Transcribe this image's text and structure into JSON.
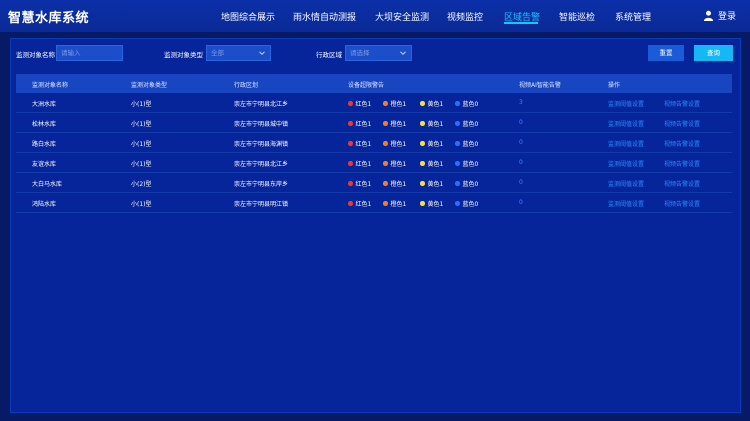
{
  "header": {
    "title": "智慧水库系统",
    "nav": [
      {
        "label": "地图综合展示"
      },
      {
        "label": "雨水情自动测报"
      },
      {
        "label": "大坝安全监测"
      },
      {
        "label": "视频监控"
      },
      {
        "label": "区域告警",
        "active": true
      },
      {
        "label": "智能巡检"
      },
      {
        "label": "系统管理"
      }
    ],
    "login_label": "登录"
  },
  "filters": {
    "name_label": "监测对象名称",
    "name_placeholder": "请输入",
    "type_label": "监测对象类型",
    "type_value": "全部",
    "region_label": "行政区域",
    "region_value": "请选择",
    "reset_label": "重置",
    "query_label": "查询"
  },
  "table": {
    "columns": [
      "监测对象名称",
      "监测对象类型",
      "行政区划",
      "设备超限警告",
      "视频AI智能告警",
      "操作"
    ],
    "alarm_colors": {
      "red": "#e23b3b",
      "orange": "#ff7a1a",
      "yellow": "#f2e23a",
      "blue": "#2f6bff"
    },
    "rows": [
      {
        "name": "大洲水库",
        "type": "小(1)型",
        "region": "崇左市宁明县北江乡",
        "red": "红色1",
        "orange": "橙色1",
        "yellow": "黄色1",
        "blue": "蓝色0",
        "ai": "3",
        "op1": "监测阈值设置",
        "op2": "视频告警设置"
      },
      {
        "name": "松林水库",
        "type": "小(1)型",
        "region": "崇左市宁明县城中镇",
        "red": "红色1",
        "orange": "橙色1",
        "yellow": "黄色1",
        "blue": "蓝色0",
        "ai": "0",
        "op1": "监测阈值设置",
        "op2": "视频告警设置"
      },
      {
        "name": "路白水库",
        "type": "小(1)型",
        "region": "崇左市宁明县海渊镇",
        "red": "红色1",
        "orange": "橙色1",
        "yellow": "黄色1",
        "blue": "蓝色0",
        "ai": "0",
        "op1": "监测阈值设置",
        "op2": "视频告警设置"
      },
      {
        "name": "友谊水库",
        "type": "小(1)型",
        "region": "崇左市宁明县北江乡",
        "red": "红色1",
        "orange": "橙色1",
        "yellow": "黄色1",
        "blue": "蓝色0",
        "ai": "0",
        "op1": "监测阈值设置",
        "op2": "视频告警设置"
      },
      {
        "name": "大白马水库",
        "type": "小(2)型",
        "region": "崇左市宁明县东岸乡",
        "red": "红色1",
        "orange": "橙色1",
        "yellow": "黄色1",
        "blue": "蓝色0",
        "ai": "0",
        "op1": "监测阈值设置",
        "op2": "视频告警设置"
      },
      {
        "name": "鸿陆水库",
        "type": "小(1)型",
        "region": "崇左市宁明县明江镇",
        "red": "红色1",
        "orange": "橙色1",
        "yellow": "黄色1",
        "blue": "蓝色0",
        "ai": "0",
        "op1": "监测阈值设置",
        "op2": "视频告警设置"
      }
    ]
  }
}
